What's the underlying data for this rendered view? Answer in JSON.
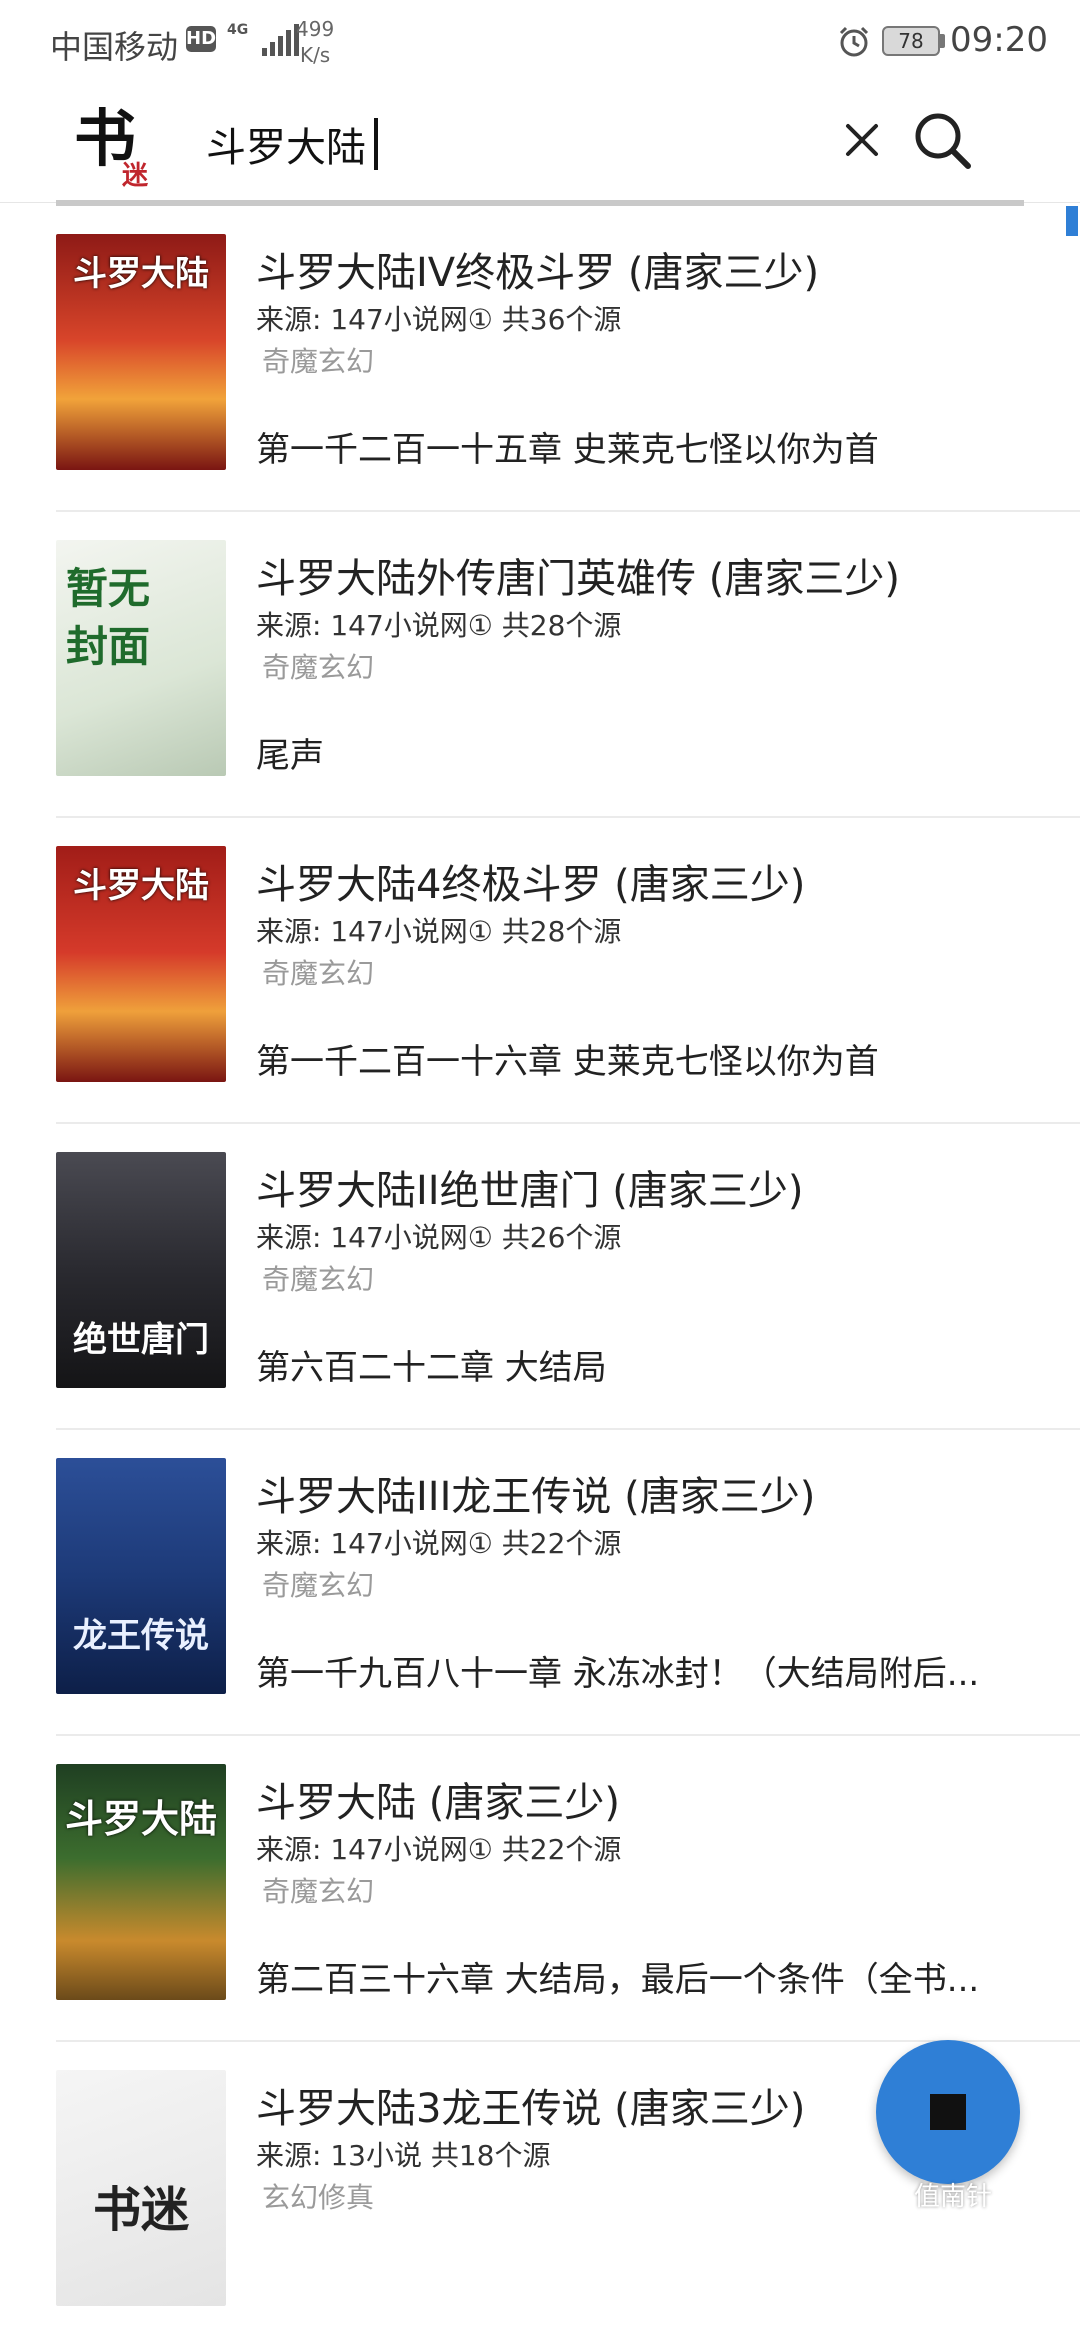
{
  "status_bar": {
    "carrier": "中国移动",
    "hd_badge": "HD",
    "network": "4G",
    "speed_value": "499",
    "speed_unit": "K/s",
    "battery": "78",
    "time": "09:20"
  },
  "search": {
    "query": "斗罗大陆"
  },
  "app": {
    "logo_main": "书",
    "logo_sub": "迷"
  },
  "results": [
    {
      "title": "斗罗大陆IV终极斗罗 (唐家三少)",
      "source": "来源: 147小说网①  共36个源",
      "genre": "奇魔玄幻",
      "latest": "第一千二百一十五章 史莱克七怪以你为首",
      "cover_text": "斗罗大陆",
      "cover_bg": "#b5241f"
    },
    {
      "title": "斗罗大陆外传唐门英雄传 (唐家三少)",
      "source": "来源: 147小说网①  共28个源",
      "genre": "奇魔玄幻",
      "latest": "尾声",
      "cover_text": "暂无封面",
      "cover_bg": "#dfe8dc"
    },
    {
      "title": "斗罗大陆4终极斗罗 (唐家三少)",
      "source": "来源: 147小说网①  共28个源",
      "genre": "奇魔玄幻",
      "latest": "第一千二百一十六章 史莱克七怪以你为首",
      "cover_text": "斗罗大陆",
      "cover_bg": "#b5241f"
    },
    {
      "title": "斗罗大陆II绝世唐门 (唐家三少)",
      "source": "来源: 147小说网①  共26个源",
      "genre": "奇魔玄幻",
      "latest": "第六百二十二章 大结局",
      "cover_text": "绝世唐门",
      "cover_bg": "#2a2a2e"
    },
    {
      "title": "斗罗大陆III龙王传说 (唐家三少)",
      "source": "来源: 147小说网①  共22个源",
      "genre": "奇魔玄幻",
      "latest": "第一千九百八十一章 永冻冰封！（大结局附后...",
      "cover_text": "龙王传说",
      "cover_bg": "#1d3a78"
    },
    {
      "title": "斗罗大陆 (唐家三少)",
      "source": "来源: 147小说网①  共22个源",
      "genre": "奇魔玄幻",
      "latest": "第二百三十六章 大结局，最后一个条件（全书...",
      "cover_text": "斗罗大陆",
      "cover_bg": "#3c6d2e"
    },
    {
      "title": "斗罗大陆3龙王传说 (唐家三少)",
      "source": "来源: 13小说  共18个源",
      "genre": "玄幻修真",
      "latest": "",
      "cover_text": "书迷",
      "cover_bg": "#ececec"
    }
  ],
  "watermark": "值南针",
  "colors": {
    "accent": "#2f7fd6",
    "genre_text": "#9a9a9a",
    "divider": "#ebebeb"
  }
}
